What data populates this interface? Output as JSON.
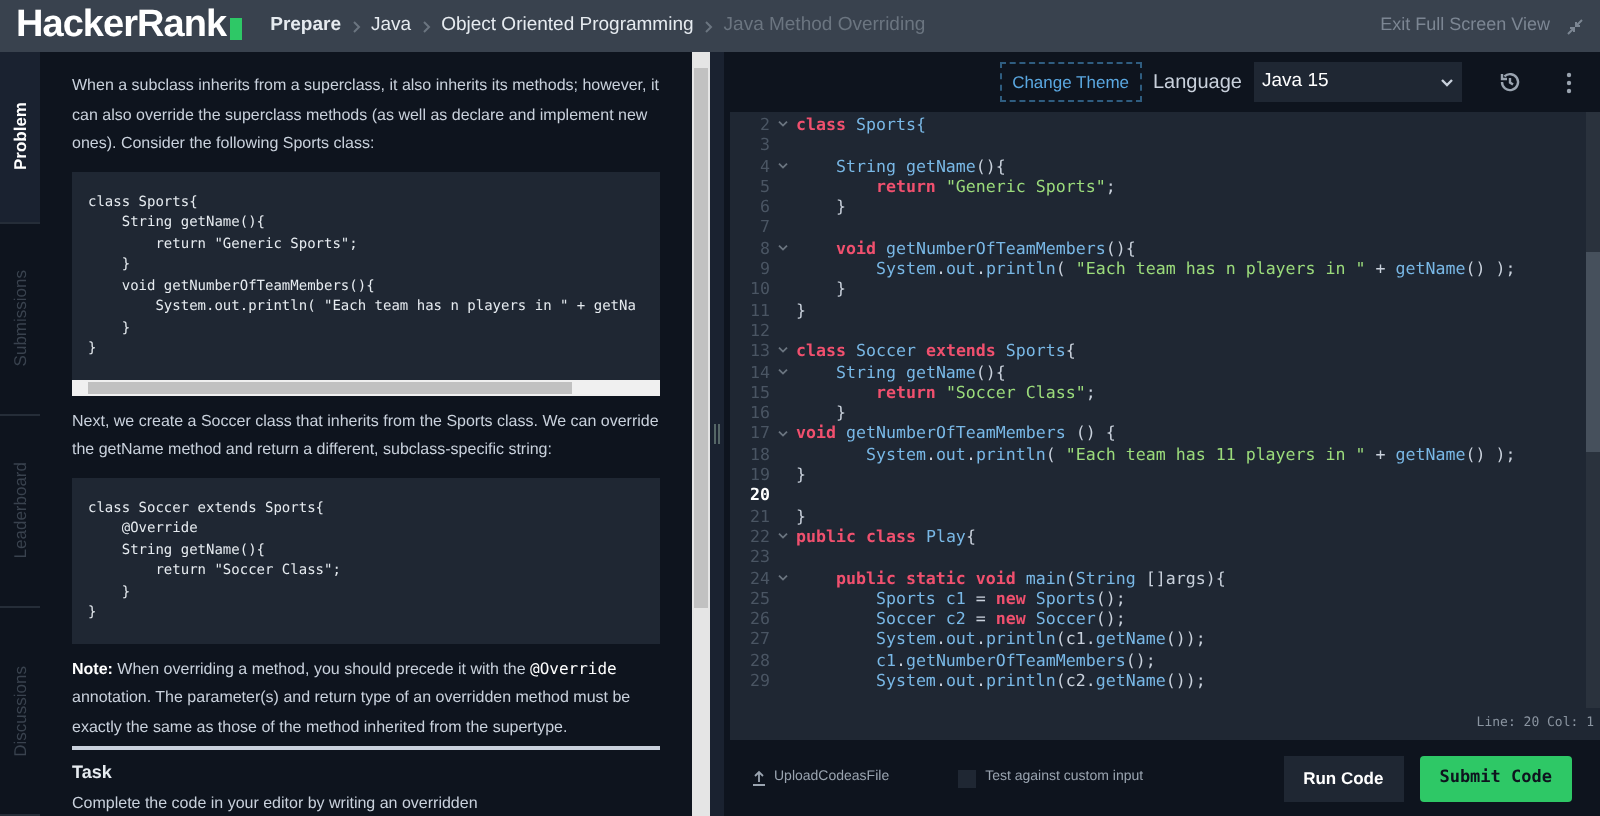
{
  "header": {
    "logo": "HackerRank",
    "breadcrumbs": [
      {
        "label": "Prepare",
        "current": false,
        "bold": true
      },
      {
        "label": "Java",
        "current": false,
        "bold": false
      },
      {
        "label": "Object Oriented Programming",
        "current": false,
        "bold": false
      },
      {
        "label": "Java Method Overriding",
        "current": true,
        "bold": false
      }
    ],
    "exit_link": "Exit Full Screen View"
  },
  "side_tabs": [
    {
      "label": "Problem",
      "selected": true
    },
    {
      "label": "Submissions",
      "selected": false
    },
    {
      "label": "Leaderboard",
      "selected": false
    },
    {
      "label": "Discussions",
      "selected": false
    }
  ],
  "problem": {
    "blocks": [
      {
        "kind": "para",
        "text": "When a subclass inherits from a superclass, it also inherits its methods; however, it can also override the superclass methods (as well as declare and implement new ones). Consider the following Sports class:"
      },
      {
        "kind": "code",
        "scrollbar": true,
        "lines": [
          "class Sports{",
          "    String getName(){",
          "        return \"Generic Sports\";",
          "    }",
          "    void getNumberOfTeamMembers(){",
          "        System.out.println( \"Each team has n players in \" + getNa",
          "    }",
          "}"
        ]
      },
      {
        "kind": "para",
        "text": "Next, we create a Soccer class that inherits from the Sports class. We can override the getName method and return a different, subclass-specific string:"
      },
      {
        "kind": "code",
        "lines": [
          "class Soccer extends Sports{",
          "    @Override",
          "    String getName(){",
          "        return \"Soccer Class\";",
          "    }",
          "}"
        ]
      },
      {
        "kind": "note",
        "label": "Note:",
        "before": " When overriding a method, you should precede it with the ",
        "code": "@Override",
        "after": " annotation. The parameter(s) and return type of an overridden method must be exactly the same as those of the method inherited from the supertype."
      },
      {
        "kind": "heading",
        "text": "Task"
      },
      {
        "kind": "para",
        "text": "Complete the code in your editor by writing an overridden"
      }
    ]
  },
  "editor": {
    "theme_button": "Change Theme",
    "language_label": "Language",
    "language": "Java 15",
    "lines": [
      {
        "no": "2",
        "fold": true,
        "current": false,
        "tokens": [
          {
            "kind": "kw",
            "text": "class"
          },
          {
            "kind": "type",
            "text": " Sports{"
          }
        ]
      },
      {
        "no": "3",
        "fold": false,
        "current": false
      },
      {
        "no": "4",
        "fold": true,
        "current": false,
        "tokens": [
          {
            "kind": "type",
            "text": "    String "
          },
          {
            "kind": "fn",
            "text": "getName"
          },
          {
            "kind": "plain",
            "text": "(){"
          }
        ]
      },
      {
        "no": "5",
        "fold": false,
        "current": false,
        "tokens": [
          {
            "kind": "kw",
            "text": "        return "
          },
          {
            "kind": "str",
            "text": "\"Generic Sports\""
          },
          {
            "kind": "plain",
            "text": ";"
          }
        ]
      },
      {
        "no": "6",
        "fold": false,
        "current": false,
        "tokens": [
          {
            "kind": "plain",
            "text": "    }"
          }
        ]
      },
      {
        "no": "7",
        "fold": false,
        "current": false
      },
      {
        "no": "8",
        "fold": true,
        "current": false,
        "tokens": [
          {
            "kind": "kw",
            "text": "    void "
          },
          {
            "kind": "fn",
            "text": "getNumberOfTeamMembers"
          },
          {
            "kind": "plain",
            "text": "(){"
          }
        ]
      },
      {
        "no": "9",
        "fold": false,
        "current": false,
        "tokens": [
          {
            "kind": "type",
            "text": "        System"
          },
          {
            "kind": "plain",
            "text": "."
          },
          {
            "kind": "fn",
            "text": "out"
          },
          {
            "kind": "plain",
            "text": "."
          },
          {
            "kind": "fn",
            "text": "println"
          },
          {
            "kind": "plain",
            "text": "( "
          },
          {
            "kind": "str",
            "text": "\"Each team has n players in \""
          },
          {
            "kind": "plain",
            "text": " + "
          },
          {
            "kind": "fn",
            "text": "getName"
          },
          {
            "kind": "plain",
            "text": "() );"
          }
        ]
      },
      {
        "no": "10",
        "fold": false,
        "current": false,
        "tokens": [
          {
            "kind": "plain",
            "text": "    }"
          }
        ]
      },
      {
        "no": "11",
        "fold": false,
        "current": false,
        "tokens": [
          {
            "kind": "plain",
            "text": "}"
          }
        ]
      },
      {
        "no": "12",
        "fold": false,
        "current": false
      },
      {
        "no": "13",
        "fold": true,
        "current": false,
        "tokens": [
          {
            "kind": "kw",
            "text": "class"
          },
          {
            "kind": "type",
            "text": " Soccer "
          },
          {
            "kind": "kw",
            "text": "extends"
          },
          {
            "kind": "type",
            "text": " Sports"
          },
          {
            "kind": "plain",
            "text": "{"
          }
        ]
      },
      {
        "no": "14",
        "fold": true,
        "current": false,
        "tokens": [
          {
            "kind": "type",
            "text": "    String "
          },
          {
            "kind": "fn",
            "text": "getName"
          },
          {
            "kind": "plain",
            "text": "(){"
          }
        ]
      },
      {
        "no": "15",
        "fold": false,
        "current": false,
        "tokens": [
          {
            "kind": "kw",
            "text": "        return "
          },
          {
            "kind": "str",
            "text": "\"Soccer Class\""
          },
          {
            "kind": "plain",
            "text": ";"
          }
        ]
      },
      {
        "no": "16",
        "fold": false,
        "current": false,
        "tokens": [
          {
            "kind": "plain",
            "text": "    }"
          }
        ]
      },
      {
        "no": "17",
        "fold": true,
        "current": false,
        "tokens": [
          {
            "kind": "kw",
            "text": "void "
          },
          {
            "kind": "fn",
            "text": "getNumberOfTeamMembers"
          },
          {
            "kind": "plain",
            "text": " () {"
          }
        ]
      },
      {
        "no": "18",
        "fold": false,
        "current": false,
        "tokens": [
          {
            "kind": "type",
            "text": "       System"
          },
          {
            "kind": "plain",
            "text": "."
          },
          {
            "kind": "fn",
            "text": "out"
          },
          {
            "kind": "plain",
            "text": "."
          },
          {
            "kind": "fn",
            "text": "println"
          },
          {
            "kind": "plain",
            "text": "( "
          },
          {
            "kind": "str",
            "text": "\"Each team has 11 players in \""
          },
          {
            "kind": "plain",
            "text": " + "
          },
          {
            "kind": "fn",
            "text": "getName"
          },
          {
            "kind": "plain",
            "text": "() );"
          }
        ]
      },
      {
        "no": "19",
        "fold": false,
        "current": false,
        "tokens": [
          {
            "kind": "plain",
            "text": "}"
          }
        ]
      },
      {
        "no": "20",
        "fold": false,
        "current": true
      },
      {
        "no": "21",
        "fold": false,
        "current": false,
        "tokens": [
          {
            "kind": "plain",
            "text": "}"
          }
        ]
      },
      {
        "no": "22",
        "fold": true,
        "current": false,
        "tokens": [
          {
            "kind": "kw",
            "text": "public class"
          },
          {
            "kind": "type",
            "text": " Play"
          },
          {
            "kind": "plain",
            "text": "{"
          }
        ]
      },
      {
        "no": "23",
        "fold": false,
        "current": false
      },
      {
        "no": "24",
        "fold": true,
        "current": false,
        "tokens": [
          {
            "kind": "kw",
            "text": "    public static void "
          },
          {
            "kind": "fn",
            "text": "main"
          },
          {
            "kind": "plain",
            "text": "("
          },
          {
            "kind": "type",
            "text": "String"
          },
          {
            "kind": "plain",
            "text": " []args){"
          }
        ]
      },
      {
        "no": "25",
        "fold": false,
        "current": false,
        "tokens": [
          {
            "kind": "type",
            "text": "        Sports c1 "
          },
          {
            "kind": "plain",
            "text": "= "
          },
          {
            "kind": "kw",
            "text": "new "
          },
          {
            "kind": "type",
            "text": "Sports"
          },
          {
            "kind": "plain",
            "text": "();"
          }
        ]
      },
      {
        "no": "26",
        "fold": false,
        "current": false,
        "tokens": [
          {
            "kind": "type",
            "text": "        Soccer c2 "
          },
          {
            "kind": "plain",
            "text": "= "
          },
          {
            "kind": "kw",
            "text": "new "
          },
          {
            "kind": "type",
            "text": "Soccer"
          },
          {
            "kind": "plain",
            "text": "();"
          }
        ]
      },
      {
        "no": "27",
        "fold": false,
        "current": false,
        "tokens": [
          {
            "kind": "type",
            "text": "        System"
          },
          {
            "kind": "plain",
            "text": "."
          },
          {
            "kind": "fn",
            "text": "out"
          },
          {
            "kind": "plain",
            "text": "."
          },
          {
            "kind": "fn",
            "text": "println"
          },
          {
            "kind": "plain",
            "text": "(c1."
          },
          {
            "kind": "fn",
            "text": "getName"
          },
          {
            "kind": "plain",
            "text": "());"
          }
        ]
      },
      {
        "no": "28",
        "fold": false,
        "current": false,
        "tokens": [
          {
            "kind": "type",
            "text": "        c1"
          },
          {
            "kind": "plain",
            "text": "."
          },
          {
            "kind": "fn",
            "text": "getNumberOfTeamMembers"
          },
          {
            "kind": "plain",
            "text": "();"
          }
        ]
      },
      {
        "no": "29",
        "fold": false,
        "current": false,
        "tokens": [
          {
            "kind": "type",
            "text": "        System"
          },
          {
            "kind": "plain",
            "text": "."
          },
          {
            "kind": "fn",
            "text": "out"
          },
          {
            "kind": "plain",
            "text": "."
          },
          {
            "kind": "fn",
            "text": "println"
          },
          {
            "kind": "plain",
            "text": "(c2."
          },
          {
            "kind": "fn",
            "text": "getName"
          },
          {
            "kind": "plain",
            "text": "());"
          }
        ]
      }
    ],
    "cursor_status": "Line: 20 Col: 1"
  },
  "footer": {
    "upload": "UploadCodeasFile",
    "custom_input": {
      "label": "Test against custom input",
      "checked": false
    },
    "run": "Run Code",
    "submit": "Submit Code"
  }
}
